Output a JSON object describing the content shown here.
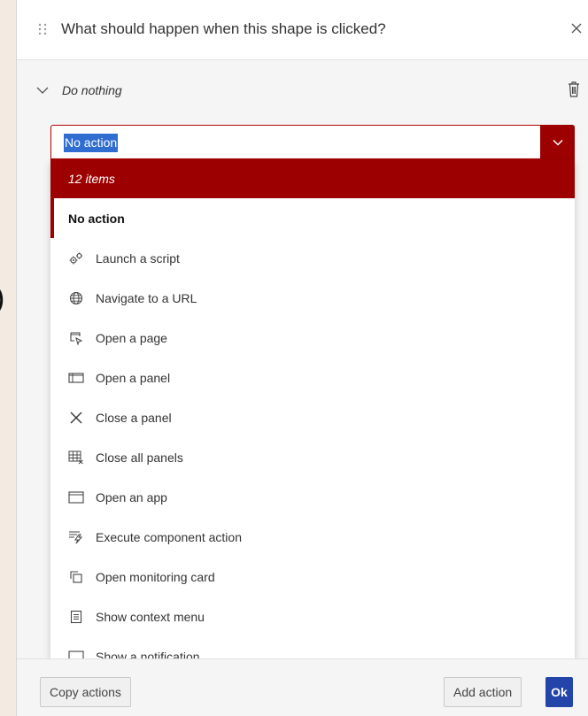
{
  "background": {
    "fragment": ")"
  },
  "dialog": {
    "title": "What should happen when this shape is clicked?",
    "action": {
      "name": "Do nothing"
    },
    "combo": {
      "value": "No action"
    },
    "dropdown": {
      "header": "12 items",
      "items": [
        {
          "label": "No action",
          "icon": "none",
          "selected": true
        },
        {
          "label": "Launch a script",
          "icon": "gears-icon"
        },
        {
          "label": "Navigate to a URL",
          "icon": "globe-icon"
        },
        {
          "label": "Open a page",
          "icon": "open-page-icon"
        },
        {
          "label": "Open a panel",
          "icon": "panel-icon"
        },
        {
          "label": "Close a panel",
          "icon": "close-icon"
        },
        {
          "label": "Close all panels",
          "icon": "close-all-panels-icon"
        },
        {
          "label": "Open an app",
          "icon": "app-window-icon"
        },
        {
          "label": "Execute component action",
          "icon": "execute-icon"
        },
        {
          "label": "Open monitoring card",
          "icon": "monitoring-card-icon"
        },
        {
          "label": "Show context menu",
          "icon": "context-menu-icon"
        },
        {
          "label": "Show a notification",
          "icon": "notification-icon"
        }
      ]
    },
    "footer": {
      "copy_label": "Copy actions",
      "add_label": "Add action",
      "ok_label": "Ok"
    }
  },
  "colors": {
    "accent": "#9d0000",
    "primary": "#2344a8",
    "selection": "#2f6dd1"
  }
}
